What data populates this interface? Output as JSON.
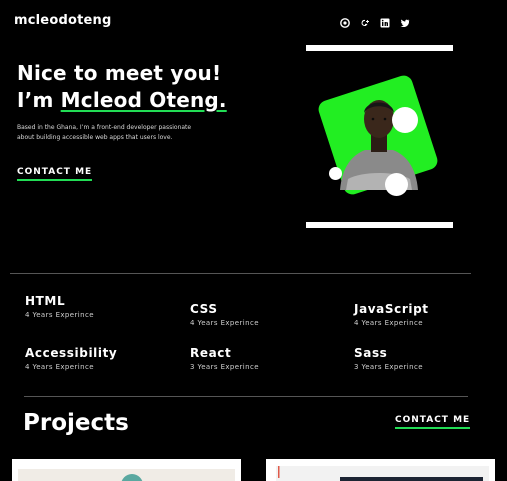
{
  "header": {
    "logo": "mcleodoteng",
    "socials": [
      {
        "name": "github",
        "icon": "github-icon"
      },
      {
        "name": "google-plus",
        "icon": "google-plus-icon"
      },
      {
        "name": "linkedin",
        "icon": "linkedin-icon"
      },
      {
        "name": "twitter",
        "icon": "twitter-icon"
      }
    ]
  },
  "hero": {
    "greeting": "Nice to meet you!",
    "intro_prefix": "I’m ",
    "name": "Mcleod Oteng.",
    "description": "Based in the Ghana, I’m a front-end developer passionate about building accessible web apps that users love.",
    "cta": "CONTACT ME"
  },
  "skills": [
    {
      "name": "HTML",
      "years": "4 Years Experince"
    },
    {
      "name": "CSS",
      "years": "4 Years Experince"
    },
    {
      "name": "JavaScript",
      "years": "4 Years Experince"
    },
    {
      "name": "Accessibility",
      "years": "4 Years Experince"
    },
    {
      "name": "React",
      "years": "3 Years Experince"
    },
    {
      "name": "Sass",
      "years": "3 Years Experince"
    }
  ],
  "projects": {
    "title": "Projects",
    "cta": "CONTACT ME"
  },
  "colors": {
    "background": "#000000",
    "accent": "#22ee22",
    "text": "#ffffff"
  }
}
